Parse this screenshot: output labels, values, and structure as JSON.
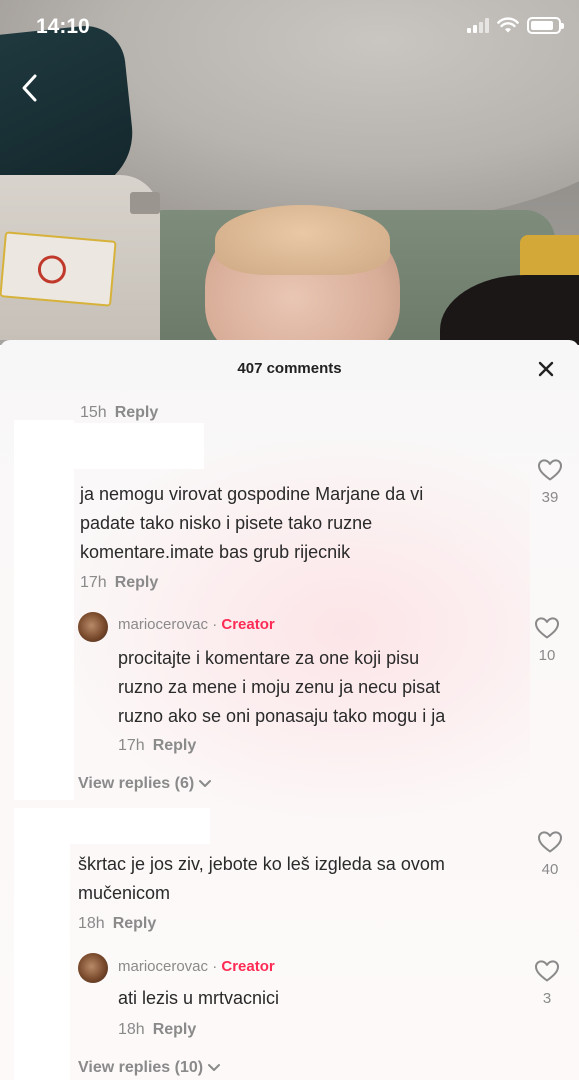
{
  "status_bar": {
    "time": "14:10",
    "battery_level": 0.85
  },
  "video": {
    "back_icon": "chevron-left-icon"
  },
  "comments_sheet": {
    "title": "407 comments",
    "close_icon": "close-icon",
    "top_meta": {
      "time": "15h",
      "reply": "Reply"
    },
    "comments": [
      {
        "text_lines": [
          "ja nemogu virovat gospodine Marjane da vi",
          "padate tako nisko i pisete tako ruzne",
          "komentare.imate bas grub rijecnik"
        ],
        "time": "17h",
        "reply": "Reply",
        "likes": "39",
        "replies": [
          {
            "username": "mariocerovac",
            "separator": " · ",
            "badge": "Creator",
            "text_lines": [
              "procitajte i komentare za one koji pisu",
              "ruzno za mene i moju zenu ja necu pisat",
              "ruzno ako se oni ponasaju tako mogu i ja"
            ],
            "time": "17h",
            "reply": "Reply",
            "likes": "10"
          }
        ],
        "view_replies": "View replies (6)"
      },
      {
        "text_lines": [
          "škrtac je jos ziv, jebote ko leš izgleda sa ovom",
          "mučenicom"
        ],
        "time": "18h",
        "reply": "Reply",
        "likes": "40",
        "replies": [
          {
            "username": "mariocerovac",
            "separator": " · ",
            "badge": "Creator",
            "text_lines": [
              "ati lezis u mrtvacnici"
            ],
            "time": "18h",
            "reply": "Reply",
            "likes": "3"
          }
        ],
        "view_replies": "View replies (10)"
      }
    ]
  }
}
